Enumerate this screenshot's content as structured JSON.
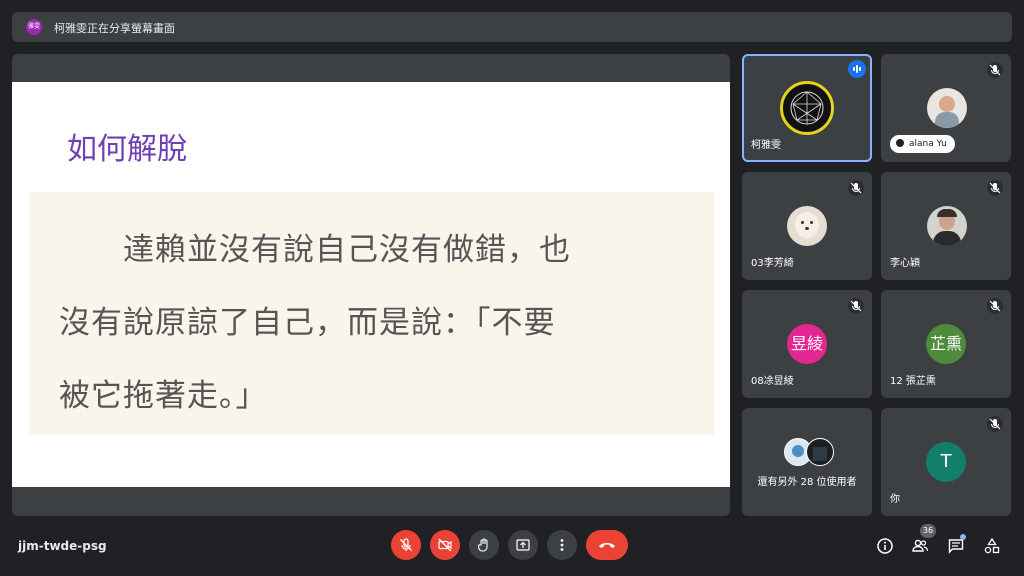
{
  "banner": {
    "avatar_text": "雅雯",
    "text": "柯雅雯正在分享螢幕畫面"
  },
  "slide": {
    "title": "如何解脫",
    "lines": [
      "　　達賴並沒有說自己沒有做錯，也",
      "沒有說原諒了自己，而是說：「不要",
      "被它拖著走。」"
    ]
  },
  "participants": [
    {
      "name": "柯雅雯",
      "speaking": true
    },
    {
      "name": "alana Yu",
      "muted": true
    },
    {
      "name": "03李芳綺",
      "muted": true
    },
    {
      "name": "李心穎",
      "muted": true
    },
    {
      "name": "08凃昱綾",
      "avatar_text": "昱綾",
      "avatar_color": "#e52592",
      "muted": true
    },
    {
      "name": "12 張芷熏",
      "avatar_text": "芷熏",
      "avatar_color": "#4e8b3a",
      "muted": true
    },
    {
      "name": "還有另外 28 位使用者"
    },
    {
      "name": "你",
      "avatar_text": "T",
      "avatar_color": "#137f6a",
      "muted": true
    }
  ],
  "bottom": {
    "meeting_code": "jjm-twde-psg",
    "participant_count": "36"
  },
  "colors": {
    "background": "#202124",
    "tile": "#3c4043",
    "danger": "#ea4335",
    "accent": "#8ab4f8",
    "slide_title": "#6f3fb5"
  },
  "icons": {
    "mic_off": "mic-off-icon",
    "camera_off": "camera-off-icon",
    "raise_hand": "hand-icon",
    "present": "present-icon",
    "more": "more-vert-icon",
    "end_call": "phone-hangup-icon",
    "info": "info-icon",
    "people": "people-icon",
    "chat": "chat-icon",
    "activities": "activities-icon"
  }
}
